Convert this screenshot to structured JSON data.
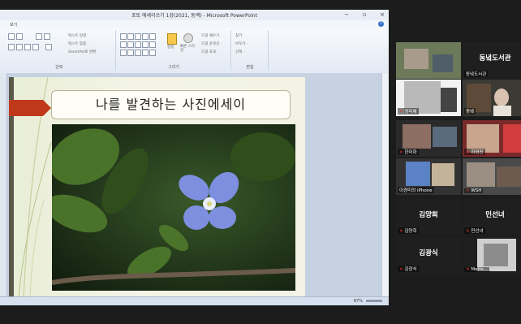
{
  "window": {
    "title": "포토 에세이쓰기 1강(2021, 동백) - Microsoft PowerPoint",
    "controls": [
      "−",
      "▫",
      "×"
    ]
  },
  "menu": {
    "tab": "보기",
    "help": "?"
  },
  "ribbon": {
    "groups": [
      {
        "label": "단락"
      },
      {
        "label": "그리기"
      },
      {
        "label": "편집"
      }
    ],
    "items": {
      "text_direction": "텍스트 방향 ·",
      "text_align": "텍스트 맞춤 ·",
      "smartart": "SmartArt로 변환 ·",
      "arrange": "정렬",
      "quick_style": "빠른 스타일",
      "shape_fill": "도형 채우기 ·",
      "shape_outline": "도형 윤곽선 ·",
      "shape_effect": "도형 효과 ·",
      "find": "찾기",
      "replace": "바꾸기 ·",
      "select": "선택 ·"
    }
  },
  "slide": {
    "title": "나를 발견하는 사진에세이"
  },
  "status": {
    "zoom": "87%"
  },
  "participants": [
    {
      "name": "",
      "big": "",
      "pixel": true
    },
    {
      "name": "동녘도서관",
      "big": "동녘도서관",
      "pixel": false,
      "mic": false
    },
    {
      "name": "정미혜",
      "big": "",
      "pixel": true,
      "mic": true
    },
    {
      "name": "동녘",
      "big": "",
      "pixel": true,
      "highlight": true
    },
    {
      "name": "한미화",
      "big": "",
      "pixel": true,
      "mic": true
    },
    {
      "name": "하경진",
      "big": "",
      "pixel": true,
      "mic": true
    },
    {
      "name": "이경미의 iPhone",
      "big": "",
      "pixel": true
    },
    {
      "name": "WSH",
      "big": "",
      "pixel": true,
      "mic": true
    },
    {
      "name": "김양희",
      "big": "김양희",
      "pixel": false,
      "mic": true
    },
    {
      "name": "민선녀",
      "big": "민선녀",
      "pixel": false,
      "mic": true
    },
    {
      "name": "김광식",
      "big": "김광식",
      "pixel": false,
      "mic": true
    },
    {
      "name": "Metts...",
      "big": "",
      "pixel": true,
      "mic": true
    }
  ],
  "colors": {
    "accent_arrow": "#c0391b",
    "highlight": "#c9e04a",
    "flower": "#7e8fe0"
  }
}
